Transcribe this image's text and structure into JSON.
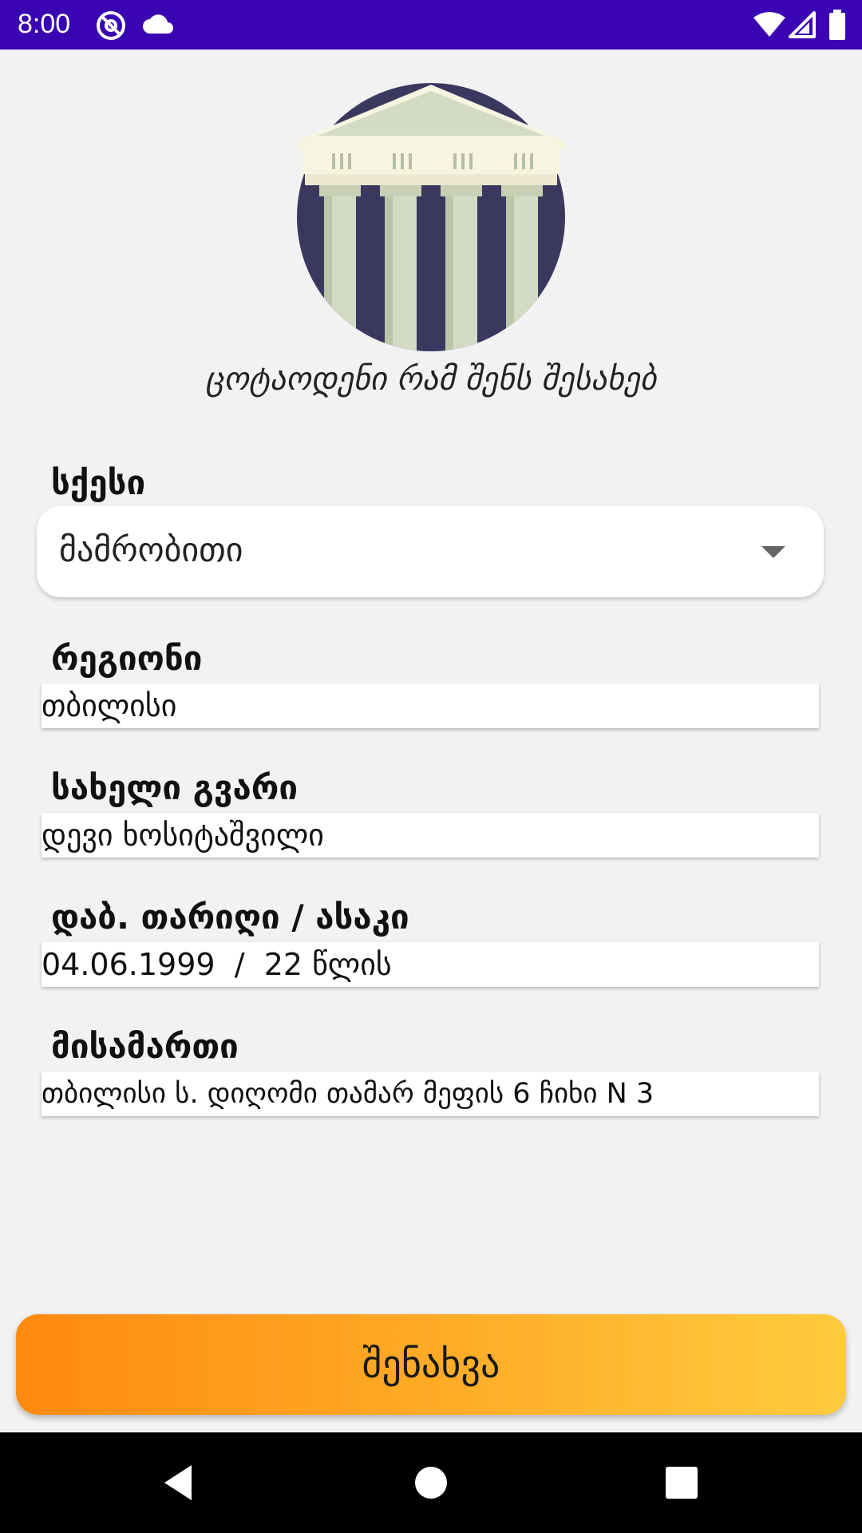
{
  "status_bar": {
    "time": "8:00",
    "background": "#3b04b2",
    "icons": [
      "at-sign-icon",
      "cloud-icon",
      "wifi-icon",
      "cell-signal-icon",
      "battery-icon"
    ]
  },
  "header": {
    "logo_icon": "greek-temple-icon",
    "subtitle": "ცოტაოდენი რამ შენს შესახებ"
  },
  "form": {
    "gender": {
      "label": "სქესი",
      "value": "მამრობითი"
    },
    "region": {
      "label": "რეგიონი",
      "value": "თბილისი"
    },
    "full_name": {
      "label": "სახელი გვარი",
      "value": "დევი ხოსიტაშვილი"
    },
    "birthdate_age": {
      "label": "დაბ. თარიღი / ასაკი",
      "value": "04.06.1999  /  22 წლის"
    },
    "address": {
      "label": "მისამართი",
      "value": "თბილისი ს. დიღომი თამარ მეფის 6 ჩიხი N 3"
    }
  },
  "actions": {
    "save_label": "შენახვა",
    "gradient_start": "#ff8a10",
    "gradient_end": "#ffcb3c"
  },
  "nav_bar": {
    "icons": [
      "back-icon",
      "home-icon",
      "recents-icon"
    ]
  }
}
